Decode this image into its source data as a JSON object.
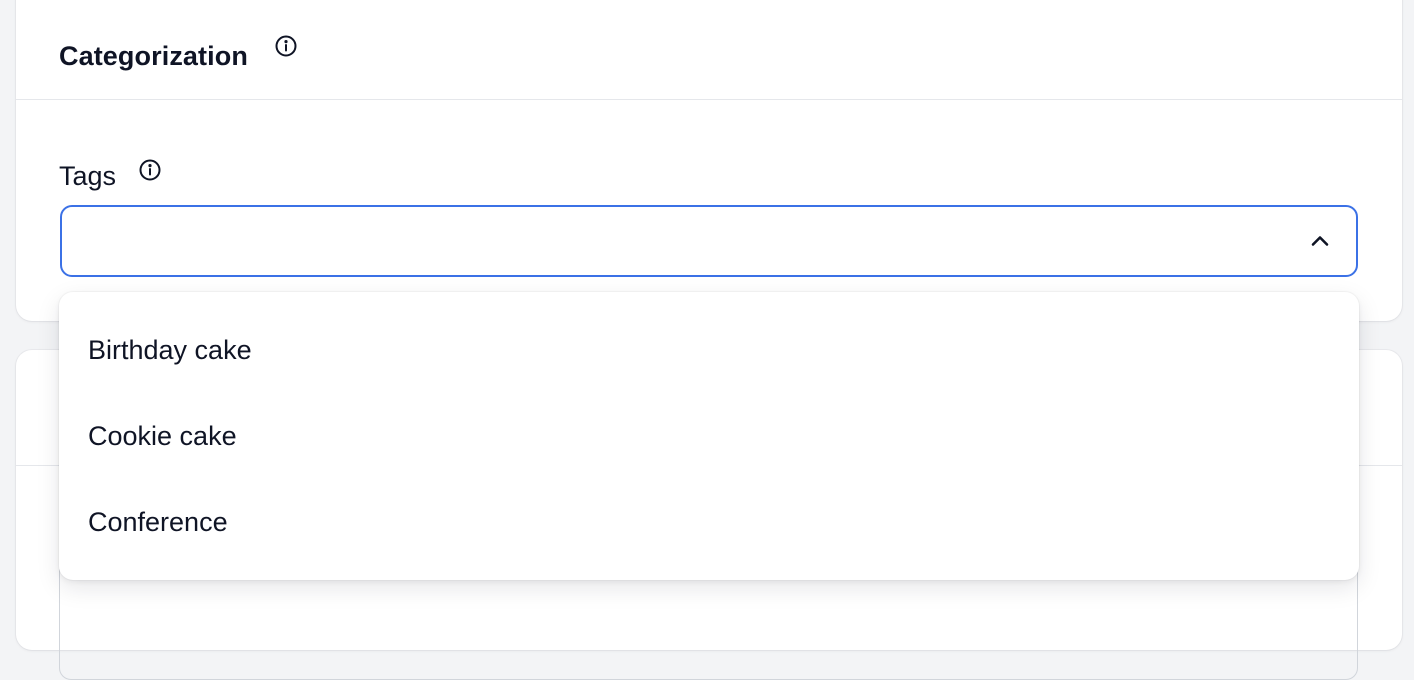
{
  "categorization": {
    "title": "Categorization",
    "title_icon": "info-icon"
  },
  "tags": {
    "label": "Tags",
    "label_icon": "info-icon",
    "value": "",
    "toggle_icon": "chevron-up-icon",
    "focus_color": "#3b71e6",
    "options": [
      {
        "label": "Birthday cake"
      },
      {
        "label": "Cookie cake"
      },
      {
        "label": "Conference"
      }
    ]
  }
}
